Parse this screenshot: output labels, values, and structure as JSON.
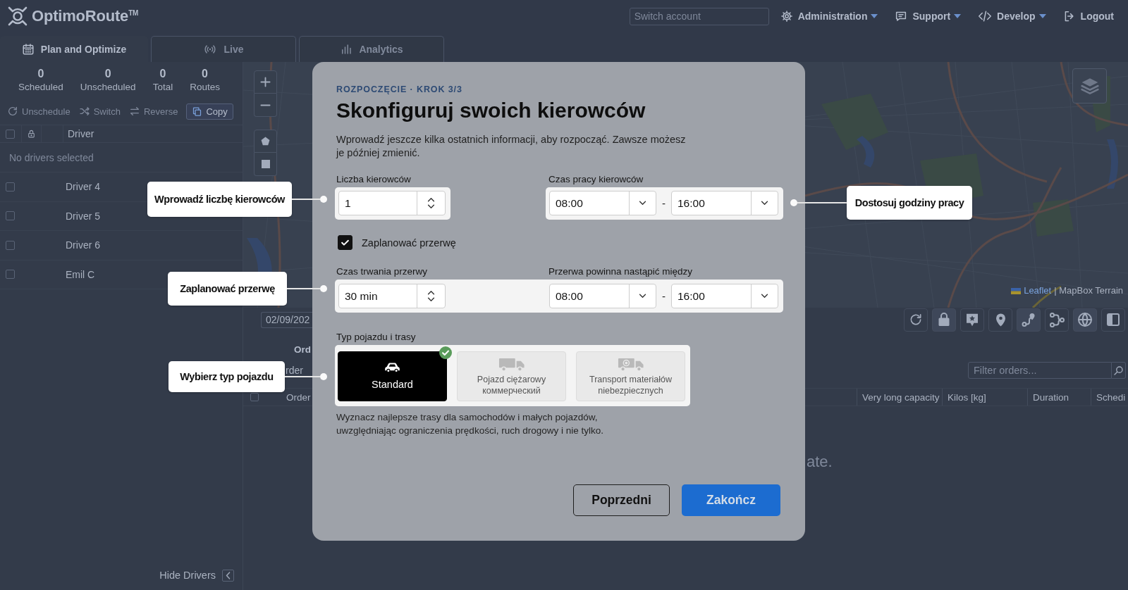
{
  "header": {
    "logo": "OptimoRoute$^{TM}$",
    "account_switch": {
      "placeholder": "Switch account"
    },
    "menu": [
      {
        "label": "Administration",
        "has_dropdown": true
      },
      {
        "label": "Support",
        "has_dropdown": true
      },
      {
        "label": "Develop",
        "has_dropdown": true
      },
      {
        "label": "Logout",
        "has_dropdown": false
      }
    ]
  },
  "tabs": [
    {
      "label": "Plan and Optimize",
      "selected": true
    },
    {
      "label": "Live",
      "selected": false
    },
    {
      "label": "Analytics",
      "selected": false
    }
  ],
  "drivers_panel": {
    "stats": [
      {
        "value": "0",
        "label": "Scheduled"
      },
      {
        "value": "0",
        "label": "Unscheduled"
      },
      {
        "value": "0",
        "label": "Total"
      },
      {
        "value": "0",
        "label": "Routes"
      }
    ],
    "actions": [
      {
        "label": "Unschedule",
        "disabled": true
      },
      {
        "label": "Switch",
        "disabled": true
      },
      {
        "label": "Reverse",
        "disabled": true
      },
      {
        "label": "Copy",
        "disabled": false
      }
    ],
    "table": {
      "select_all_checked": false,
      "columns": [
        "Driver"
      ],
      "empty_message": "No drivers selected",
      "rows": [
        {
          "name": "Driver 4",
          "checked": false
        },
        {
          "name": "Driver 5",
          "checked": false
        },
        {
          "name": "Driver 6",
          "checked": false
        },
        {
          "name": "Emil C",
          "checked": false
        }
      ]
    },
    "hide_button": "Hide Drivers"
  },
  "map": {
    "attribution": {
      "link": "Leaflet",
      "text": "| MapBox Terrain"
    }
  },
  "map_toolbar": {
    "date": "02/09/202",
    "tools": [
      {
        "selected": false
      },
      {
        "selected": true
      },
      {
        "selected": false
      },
      {
        "selected": false
      },
      {
        "selected": true
      },
      {
        "selected": false
      },
      {
        "selected": true
      },
      {
        "selected": false
      }
    ]
  },
  "orders": {
    "partial_title": "Ord",
    "partial_text_1": "rder",
    "filter": {
      "placeholder": "Filter orders..."
    },
    "select_all_checked": false,
    "columns": [
      "Order",
      "Very long capacity",
      "Kilos [kg]",
      "Duration",
      "Schedi"
    ],
    "partial_text_2": "ate."
  },
  "modal": {
    "step": "ROZPOCZĘCIE · KROK 3/3",
    "title": "Skonfiguruj swoich kierowców",
    "description": "Wprowadź jeszcze kilka ostatnich informacji, aby rozpocząć. Zawsze możesz je później zmienić.",
    "driver_count": {
      "label": "Liczba kierowców",
      "value": "1"
    },
    "working_hours": {
      "label": "Czas pracy kierowców",
      "from": "08:00",
      "separator": "-",
      "to": "16:00"
    },
    "schedule_break": {
      "label": "Zaplanować przerwę",
      "checked": true
    },
    "break_duration": {
      "label": "Czas trwania przerwy",
      "value": "30 min"
    },
    "break_window": {
      "label": "Przerwa powinna nastąpić między",
      "from": "08:00",
      "separator": "-",
      "to": "16:00"
    },
    "vehicle_type": {
      "label": "Typ pojazdu i trasy",
      "options": [
        {
          "label": "Standard",
          "selected": true
        },
        {
          "label": "Pojazd ciężarowy коммерческий",
          "selected": false
        },
        {
          "label": "Transport materiałów niebezpiecznych",
          "selected": false
        }
      ],
      "description": "Wyznacz najlepsze trasy dla samochodów i małych pojazdów, uwzględniając ograniczenia prędkości, ruch drogowy i nie tylko."
    },
    "buttons": [
      {
        "label": "Poprzedni",
        "kind": "secondary"
      },
      {
        "label": "Zakończ",
        "kind": "primary"
      }
    ]
  },
  "callouts": [
    "Wprowadź liczbę kierowców",
    "Dostosuj godziny pracy",
    "Zaplanować przerwę",
    "Wybierz typ pojazdu"
  ]
}
